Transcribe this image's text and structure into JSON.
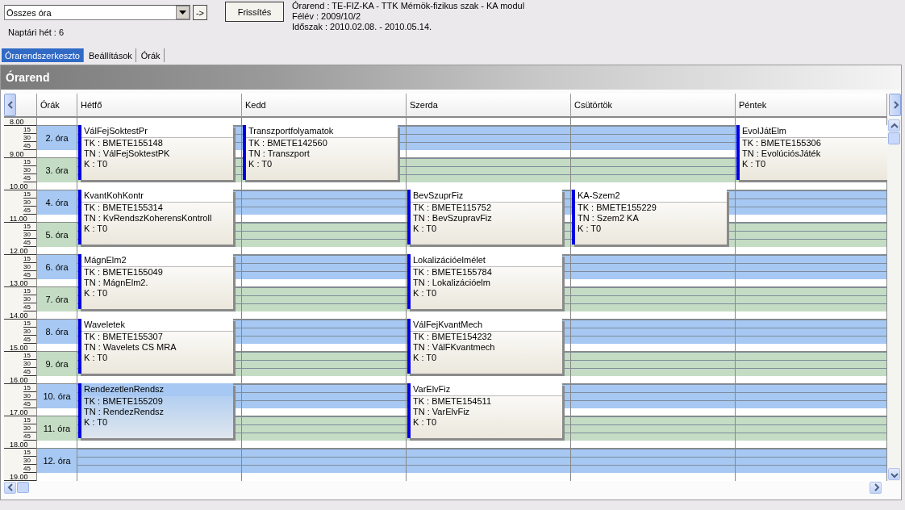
{
  "toolbar": {
    "filter": {
      "value": "Összes óra"
    },
    "go_button": "->",
    "refresh_button": "Frissítés",
    "week_label": "Naptári hét : 6",
    "info": [
      "Órarend : TE-FIZ-KA - TTK Mérnök-fizikus szak - KA modul",
      "Félév : 2009/10/2",
      "Időszak : 2010.02.08. - 2010.05.14."
    ]
  },
  "tabs": [
    {
      "label": "Órarendszerkeszto",
      "selected": true
    },
    {
      "label": "Beállítások",
      "selected": false
    },
    {
      "label": "Órák",
      "selected": false
    }
  ],
  "panel_title": "Órarend",
  "calendar": {
    "periods_header": "Órák",
    "hours": [
      {
        "label": "8.00",
        "quarters": [
          "15",
          "30",
          "45"
        ]
      },
      {
        "label": "9.00",
        "quarters": [
          "15",
          "30",
          "45"
        ]
      },
      {
        "label": "10.00",
        "quarters": [
          "15",
          "30",
          "45"
        ]
      },
      {
        "label": "11.00",
        "quarters": [
          "15",
          "30",
          "45"
        ]
      },
      {
        "label": "12.00",
        "quarters": [
          "15",
          "30",
          "45"
        ]
      },
      {
        "label": "13.00",
        "quarters": [
          "15",
          "30",
          "45"
        ]
      },
      {
        "label": "14.00",
        "quarters": [
          "15",
          "30",
          "45"
        ]
      },
      {
        "label": "15.00",
        "quarters": [
          "15",
          "30",
          "45"
        ]
      },
      {
        "label": "16.00",
        "quarters": [
          "15",
          "30",
          "45"
        ]
      },
      {
        "label": "17.00",
        "quarters": [
          "15",
          "30",
          "45"
        ]
      },
      {
        "label": "18.00",
        "quarters": [
          "15",
          "30",
          "45"
        ]
      }
    ],
    "end_hour": "19.00",
    "periods": [
      {
        "label": "2. óra",
        "color": "#a6c8f2"
      },
      {
        "label": "3. óra",
        "color": "#c4dcc4"
      },
      {
        "label": "4. óra",
        "color": "#a6c8f2"
      },
      {
        "label": "5. óra",
        "color": "#c4dcc4"
      },
      {
        "label": "6. óra",
        "color": "#a6c8f2"
      },
      {
        "label": "7. óra",
        "color": "#c4dcc4"
      },
      {
        "label": "8. óra",
        "color": "#a6c8f2"
      },
      {
        "label": "9. óra",
        "color": "#c4dcc4"
      },
      {
        "label": "10. óra",
        "color": "#a6c8f2"
      },
      {
        "label": "11. óra",
        "color": "#c4dcc4"
      },
      {
        "label": "12. óra",
        "color": "#a6c8f2"
      }
    ],
    "days": [
      {
        "label": "Hétfő",
        "blocks": [
          {
            "kind": "event",
            "title": "VálFejSoktestPr",
            "lines": [
              "TK : BMETE155148",
              "TN : VálFejSoktestPK",
              "K : T0"
            ],
            "selected": false
          },
          {
            "kind": "event",
            "title": "KvantKohKontr",
            "lines": [
              "TK : BMETE155314",
              "TN : KvRendszKoherensKontroll",
              "K : T0"
            ],
            "selected": false
          },
          {
            "kind": "event",
            "title": "MágnElm2",
            "lines": [
              "TK : BMETE155049",
              "TN : MágnElm2.",
              "K : T0"
            ],
            "selected": false
          },
          {
            "kind": "event",
            "title": "Waveletek",
            "lines": [
              "TK : BMETE155307",
              "TN : Wavelets CS MRA",
              "K : T0"
            ],
            "selected": false
          },
          {
            "kind": "event",
            "title": "RendezetlenRendsz",
            "lines": [
              "TK : BMETE155209",
              "TN : RendezRendsz",
              "K : T0"
            ],
            "selected": true
          }
        ]
      },
      {
        "label": "Kedd",
        "blocks": [
          {
            "kind": "event",
            "title": "Transzportfolyamatok",
            "lines": [
              "TK : BMETE142560",
              "TN : Transzport",
              "K : T0"
            ],
            "selected": false
          }
        ]
      },
      {
        "label": "Szerda",
        "blocks": [
          {
            "kind": "free"
          },
          {
            "kind": "event",
            "title": "BevSzuprFiz",
            "lines": [
              "TK : BMETE115752",
              "TN : BevSzupravFiz",
              "K : T0"
            ],
            "selected": false
          },
          {
            "kind": "event",
            "title": "Lokalizációelmélet",
            "lines": [
              "TK : BMETE155784",
              "TN : Lokalizációelm",
              "K : T0"
            ],
            "selected": false
          },
          {
            "kind": "event",
            "title": "VálFejKvantMech",
            "lines": [
              "TK : BMETE154232",
              "TN : VálFKvantmech",
              "K : T0"
            ],
            "selected": false
          },
          {
            "kind": "event",
            "title": "VarElvFiz",
            "lines": [
              "TK : BMETE154511",
              "TN : VarElvFiz",
              "K : T0"
            ],
            "selected": false
          }
        ]
      },
      {
        "label": "Csütörtök",
        "blocks": [
          {
            "kind": "free"
          },
          {
            "kind": "event",
            "title": "KA-Szem2",
            "lines": [
              "TK : BMETE155229",
              "TN : Szem2 KA",
              "K : T0"
            ],
            "selected": false
          }
        ]
      },
      {
        "label": "Péntek",
        "blocks": [
          {
            "kind": "event",
            "title": "EvolJátElm",
            "lines": [
              "TK : BMETE155306",
              "TN : EvolúciósJáték",
              "K : T0"
            ],
            "selected": false
          }
        ]
      }
    ]
  }
}
